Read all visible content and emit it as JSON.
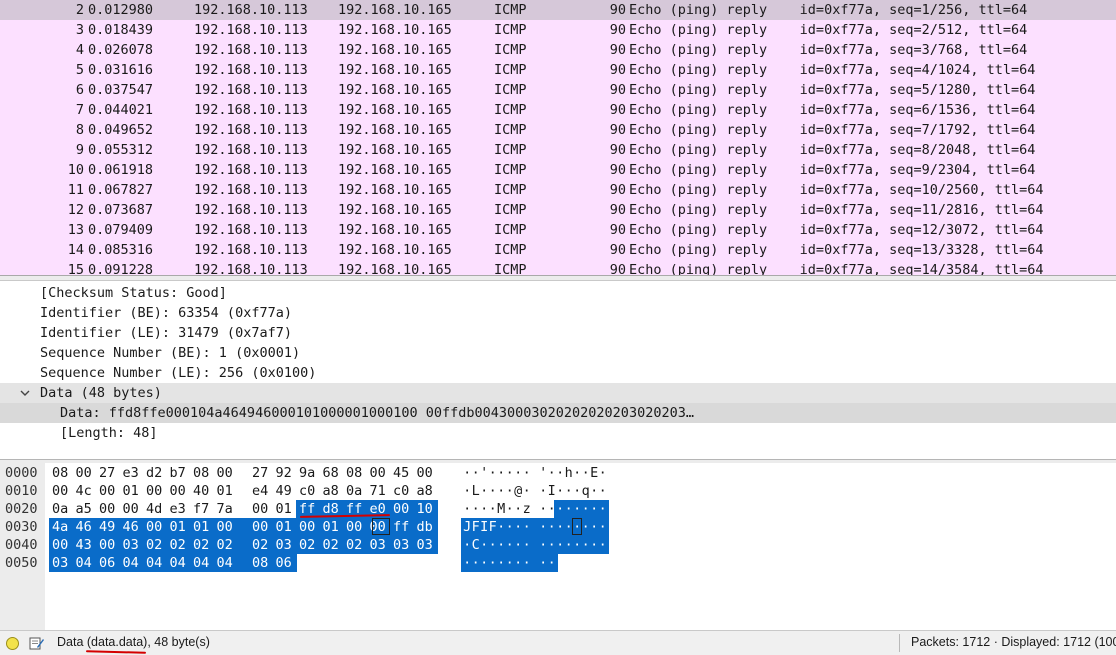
{
  "packet_list": {
    "rows": [
      {
        "no": "2",
        "time": "0.012980",
        "src": "192.168.10.113",
        "dst": "192.168.10.165",
        "proto": "ICMP",
        "len": "90",
        "info": "Echo (ping) reply    id=0xf77a, seq=1/256, ttl=64"
      },
      {
        "no": "3",
        "time": "0.018439",
        "src": "192.168.10.113",
        "dst": "192.168.10.165",
        "proto": "ICMP",
        "len": "90",
        "info": "Echo (ping) reply    id=0xf77a, seq=2/512, ttl=64"
      },
      {
        "no": "4",
        "time": "0.026078",
        "src": "192.168.10.113",
        "dst": "192.168.10.165",
        "proto": "ICMP",
        "len": "90",
        "info": "Echo (ping) reply    id=0xf77a, seq=3/768, ttl=64"
      },
      {
        "no": "5",
        "time": "0.031616",
        "src": "192.168.10.113",
        "dst": "192.168.10.165",
        "proto": "ICMP",
        "len": "90",
        "info": "Echo (ping) reply    id=0xf77a, seq=4/1024, ttl=64"
      },
      {
        "no": "6",
        "time": "0.037547",
        "src": "192.168.10.113",
        "dst": "192.168.10.165",
        "proto": "ICMP",
        "len": "90",
        "info": "Echo (ping) reply    id=0xf77a, seq=5/1280, ttl=64"
      },
      {
        "no": "7",
        "time": "0.044021",
        "src": "192.168.10.113",
        "dst": "192.168.10.165",
        "proto": "ICMP",
        "len": "90",
        "info": "Echo (ping) reply    id=0xf77a, seq=6/1536, ttl=64"
      },
      {
        "no": "8",
        "time": "0.049652",
        "src": "192.168.10.113",
        "dst": "192.168.10.165",
        "proto": "ICMP",
        "len": "90",
        "info": "Echo (ping) reply    id=0xf77a, seq=7/1792, ttl=64"
      },
      {
        "no": "9",
        "time": "0.055312",
        "src": "192.168.10.113",
        "dst": "192.168.10.165",
        "proto": "ICMP",
        "len": "90",
        "info": "Echo (ping) reply    id=0xf77a, seq=8/2048, ttl=64"
      },
      {
        "no": "10",
        "time": "0.061918",
        "src": "192.168.10.113",
        "dst": "192.168.10.165",
        "proto": "ICMP",
        "len": "90",
        "info": "Echo (ping) reply    id=0xf77a, seq=9/2304, ttl=64"
      },
      {
        "no": "11",
        "time": "0.067827",
        "src": "192.168.10.113",
        "dst": "192.168.10.165",
        "proto": "ICMP",
        "len": "90",
        "info": "Echo (ping) reply    id=0xf77a, seq=10/2560, ttl=64"
      },
      {
        "no": "12",
        "time": "0.073687",
        "src": "192.168.10.113",
        "dst": "192.168.10.165",
        "proto": "ICMP",
        "len": "90",
        "info": "Echo (ping) reply    id=0xf77a, seq=11/2816, ttl=64"
      },
      {
        "no": "13",
        "time": "0.079409",
        "src": "192.168.10.113",
        "dst": "192.168.10.165",
        "proto": "ICMP",
        "len": "90",
        "info": "Echo (ping) reply    id=0xf77a, seq=12/3072, ttl=64"
      },
      {
        "no": "14",
        "time": "0.085316",
        "src": "192.168.10.113",
        "dst": "192.168.10.165",
        "proto": "ICMP",
        "len": "90",
        "info": "Echo (ping) reply    id=0xf77a, seq=13/3328, ttl=64"
      },
      {
        "no": "15",
        "time": "0.091228",
        "src": "192.168.10.113",
        "dst": "192.168.10.165",
        "proto": "ICMP",
        "len": "90",
        "info": "Echo (ping) reply    id=0xf77a, seq=14/3584, ttl=64"
      }
    ]
  },
  "details": {
    "lines": [
      "[Checksum Status: Good]",
      "Identifier (BE): 63354 (0xf77a)",
      "Identifier (LE): 31479 (0x7af7)",
      "Sequence Number (BE): 1 (0x0001)",
      "Sequence Number (LE): 256 (0x0100)"
    ],
    "data_node": "Data (48 bytes)",
    "data_value": "Data: ffd8ffe000104a464946000101000001000100 00ffdb00430003020202020203020203…",
    "data_length": "[Length: 48]"
  },
  "bytes": {
    "rows": [
      {
        "offset": "0000",
        "hex": [
          "08",
          "00",
          "27",
          "e3",
          "d2",
          "b7",
          "08",
          "00",
          "27",
          "92",
          "9a",
          "68",
          "08",
          "00",
          "45",
          "00"
        ],
        "ascii": [
          "·",
          "·",
          "'",
          "·",
          "·",
          "·",
          "·",
          "·",
          "'",
          "·",
          "·",
          "h",
          "·",
          "·",
          "E",
          "·"
        ]
      },
      {
        "offset": "0010",
        "hex": [
          "00",
          "4c",
          "00",
          "01",
          "00",
          "00",
          "40",
          "01",
          "e4",
          "49",
          "c0",
          "a8",
          "0a",
          "71",
          "c0",
          "a8"
        ],
        "ascii": [
          "·",
          "L",
          "·",
          "·",
          "·",
          "·",
          "@",
          "·",
          "·",
          "I",
          "·",
          "·",
          "·",
          "q",
          "·",
          "·"
        ]
      },
      {
        "offset": "0020",
        "hex": [
          "0a",
          "a5",
          "00",
          "00",
          "4d",
          "e3",
          "f7",
          "7a",
          "00",
          "01",
          "ff",
          "d8",
          "ff",
          "e0",
          "00",
          "10"
        ],
        "ascii": [
          "·",
          "·",
          "·",
          "·",
          "M",
          "·",
          "·",
          "z",
          "·",
          "·",
          "·",
          "·",
          "·",
          "·",
          "·",
          "·"
        ]
      },
      {
        "offset": "0030",
        "hex": [
          "4a",
          "46",
          "49",
          "46",
          "00",
          "01",
          "01",
          "00",
          "00",
          "01",
          "00",
          "01",
          "00",
          "00",
          "ff",
          "db"
        ],
        "ascii": [
          "J",
          "F",
          "I",
          "F",
          "·",
          "·",
          "·",
          "·",
          "·",
          "·",
          "·",
          "·",
          "·",
          "·",
          "·",
          "·"
        ]
      },
      {
        "offset": "0040",
        "hex": [
          "00",
          "43",
          "00",
          "03",
          "02",
          "02",
          "02",
          "02",
          "02",
          "03",
          "02",
          "02",
          "02",
          "03",
          "03",
          "03"
        ],
        "ascii": [
          "·",
          "C",
          "·",
          "·",
          "·",
          "·",
          "·",
          "·",
          "·",
          "·",
          "·",
          "·",
          "·",
          "·",
          "·",
          "·"
        ]
      },
      {
        "offset": "0050",
        "hex": [
          "03",
          "04",
          "06",
          "04",
          "04",
          "04",
          "04",
          "04",
          "08",
          "06"
        ],
        "ascii": [
          "·",
          "·",
          "·",
          "·",
          "·",
          "·",
          "·",
          "·",
          "·",
          "·"
        ]
      }
    ]
  },
  "status": {
    "field_text": "Data (data.data), 48 byte(s)",
    "packets_text": "Packets: 1712 · Displayed: 1712 (100"
  },
  "colors": {
    "icmp_row_bg": "#fce0ff",
    "selected_row_bg": "#d6c8d9",
    "byte_selection": "#0a6cc9",
    "annotation_red": "#d40000"
  }
}
